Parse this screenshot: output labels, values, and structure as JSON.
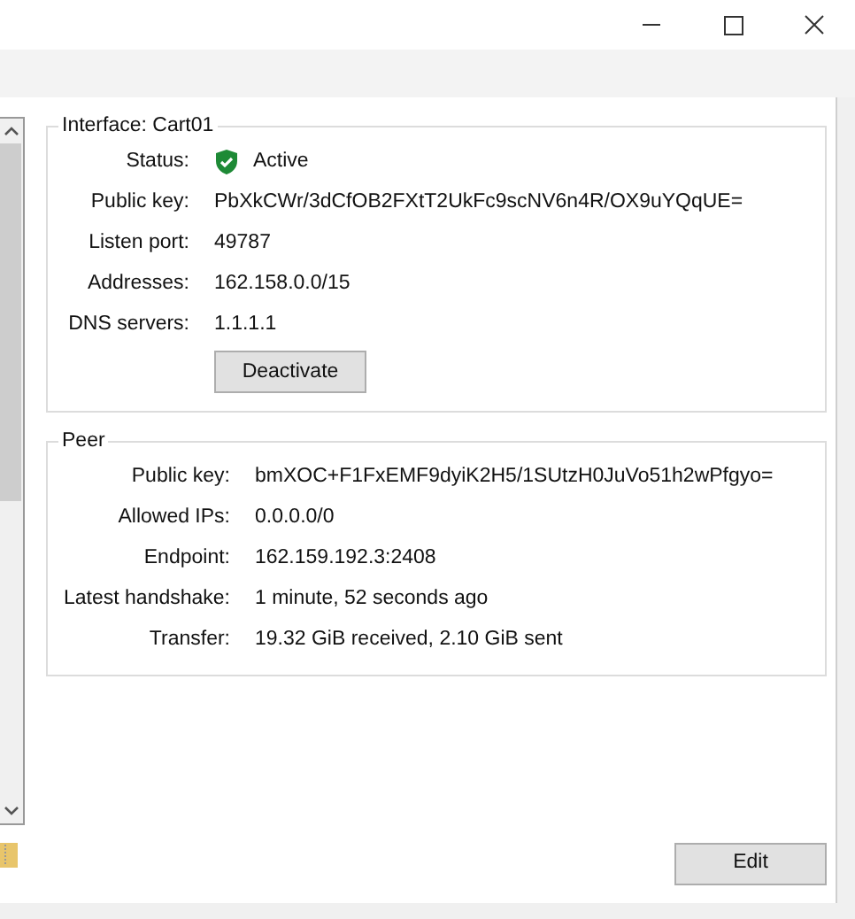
{
  "window": {
    "controls": [
      {
        "kind": "minimize"
      },
      {
        "kind": "maximize"
      },
      {
        "kind": "close"
      }
    ]
  },
  "interface": {
    "title": "Interface: Cart01",
    "status": {
      "label": "Status:",
      "value": "Active"
    },
    "rows": [
      {
        "label": "Public key:",
        "value": "PbXkCWr/3dCfOB2FXtT2UkFc9scNV6n4R/OX9uYQqUE="
      },
      {
        "label": "Listen port:",
        "value": "49787"
      },
      {
        "label": "Addresses:",
        "value": "162.158.0.0/15"
      },
      {
        "label": "DNS servers:",
        "value": "1.1.1.1"
      }
    ],
    "button": "Deactivate"
  },
  "peer": {
    "title": "Peer",
    "rows": [
      {
        "label": "Public key:",
        "value": "bmXOC+F1FxEMF9dyiK2H5/1SUtzH0JuVo51h2wPfgyo="
      },
      {
        "label": "Allowed IPs:",
        "value": "0.0.0.0/0"
      },
      {
        "label": "Endpoint:",
        "value": "162.159.192.3:2408"
      },
      {
        "label": "Latest handshake:",
        "value": "1 minute, 52 seconds ago"
      },
      {
        "label": "Transfer:",
        "value": "19.32 GiB received, 2.10 GiB sent"
      }
    ]
  },
  "edit_button": "Edit"
}
